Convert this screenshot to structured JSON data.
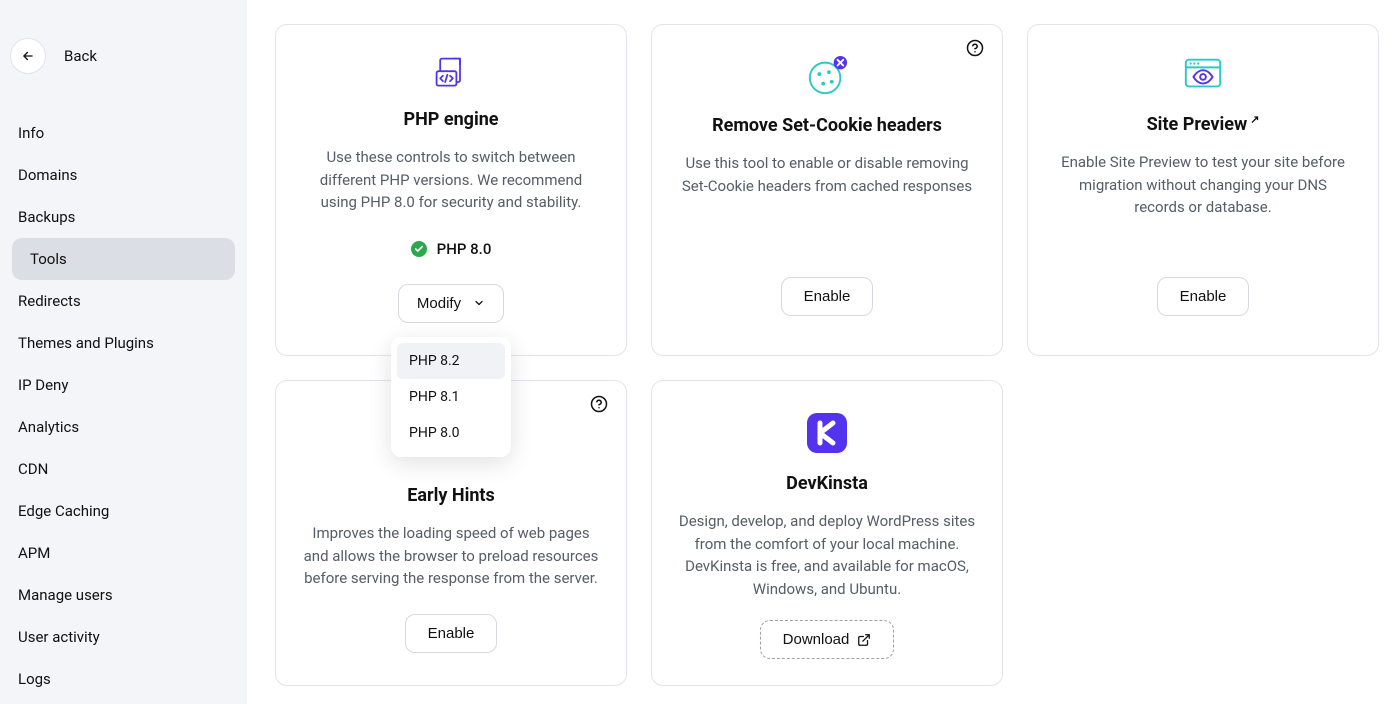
{
  "sidebar": {
    "back_label": "Back",
    "items": [
      {
        "label": "Info",
        "active": false
      },
      {
        "label": "Domains",
        "active": false
      },
      {
        "label": "Backups",
        "active": false
      },
      {
        "label": "Tools",
        "active": true
      },
      {
        "label": "Redirects",
        "active": false
      },
      {
        "label": "Themes and Plugins",
        "active": false
      },
      {
        "label": "IP Deny",
        "active": false
      },
      {
        "label": "Analytics",
        "active": false
      },
      {
        "label": "CDN",
        "active": false
      },
      {
        "label": "Edge Caching",
        "active": false
      },
      {
        "label": "APM",
        "active": false
      },
      {
        "label": "Manage users",
        "active": false
      },
      {
        "label": "User activity",
        "active": false
      },
      {
        "label": "Logs",
        "active": false
      }
    ]
  },
  "cards": {
    "php": {
      "title": "PHP engine",
      "description": "Use these controls to switch between different PHP versions. We recommend using PHP 8.0 for security and stability.",
      "status_label": "PHP 8.0",
      "modify_label": "Modify",
      "dropdown_options": [
        "PHP 8.2",
        "PHP 8.1",
        "PHP 8.0"
      ]
    },
    "cookie": {
      "title": "Remove Set-Cookie headers",
      "description": "Use this tool to enable or disable removing Set-Cookie headers from cached responses",
      "button_label": "Enable"
    },
    "preview": {
      "title": "Site Preview",
      "description": "Enable Site Preview to test your site before migration without changing your DNS records or database.",
      "button_label": "Enable"
    },
    "earlyhints": {
      "title": "Early Hints",
      "description": "Improves the loading speed of web pages and allows the browser to preload resources before serving the response from the server.",
      "button_label": "Enable"
    },
    "devkinsta": {
      "title": "DevKinsta",
      "description": "Design, develop, and deploy WordPress sites from the comfort of your local machine. DevKinsta is free, and available for macOS, Windows, and Ubuntu.",
      "button_label": "Download"
    }
  },
  "colors": {
    "php_icon": "#5333ED",
    "cookie_icon": "#2CC9C2",
    "cookie_badge": "#5333ED",
    "preview_icon": "#2CC9C2",
    "devkinsta_bg": "#5333ED"
  }
}
